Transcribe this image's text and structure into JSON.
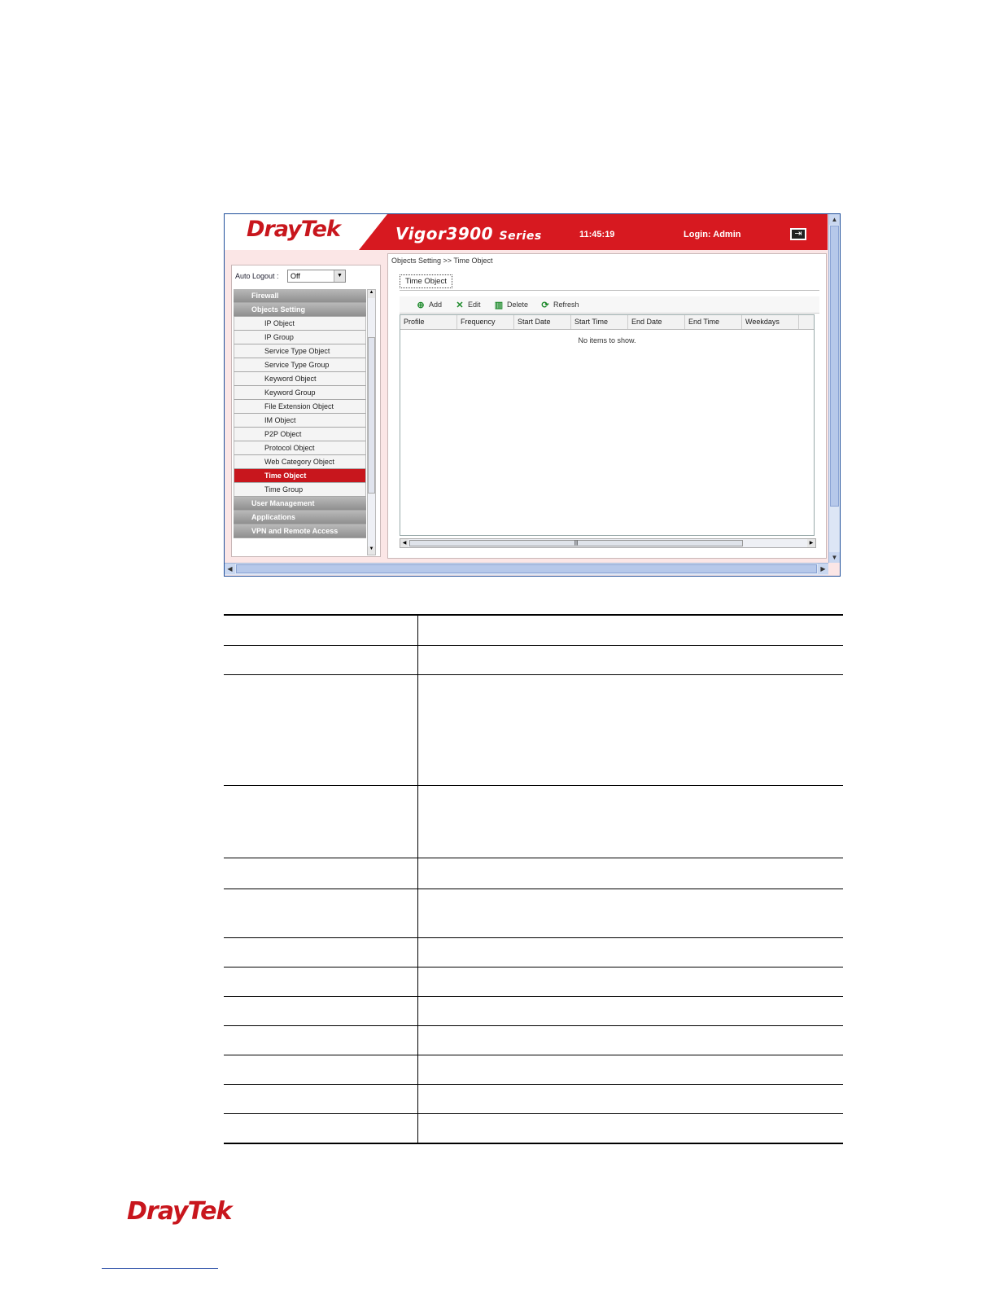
{
  "header": {
    "brand_dray": "Dray",
    "brand_tek": "Tek",
    "model": "Vigor3900",
    "series": "Series",
    "clock": "11:45:19",
    "login": "Login: Admin",
    "logout_icon": "logout-icon"
  },
  "left_panel": {
    "auto_logout_label": "Auto Logout :",
    "auto_logout_value": "Off",
    "menu": [
      {
        "label": "Firewall",
        "type": "group"
      },
      {
        "label": "Objects Setting",
        "type": "group"
      },
      {
        "label": "IP Object",
        "type": "sub"
      },
      {
        "label": "IP Group",
        "type": "sub"
      },
      {
        "label": "Service Type Object",
        "type": "sub"
      },
      {
        "label": "Service Type Group",
        "type": "sub"
      },
      {
        "label": "Keyword Object",
        "type": "sub"
      },
      {
        "label": "Keyword Group",
        "type": "sub"
      },
      {
        "label": "File Extension Object",
        "type": "sub"
      },
      {
        "label": "IM Object",
        "type": "sub"
      },
      {
        "label": "P2P Object",
        "type": "sub"
      },
      {
        "label": "Protocol Object",
        "type": "sub"
      },
      {
        "label": "Web Category Object",
        "type": "sub"
      },
      {
        "label": "Time Object",
        "type": "sub",
        "active": true
      },
      {
        "label": "Time Group",
        "type": "sub"
      },
      {
        "label": "User Management",
        "type": "group"
      },
      {
        "label": "Applications",
        "type": "group"
      },
      {
        "label": "VPN and Remote Access",
        "type": "group"
      }
    ]
  },
  "main": {
    "breadcrumb": "Objects Setting >> Time Object",
    "tab": "Time Object",
    "toolbar": {
      "add": "Add",
      "edit": "Edit",
      "delete": "Delete",
      "refresh": "Refresh"
    },
    "columns": [
      "Profile",
      "Frequency",
      "Start Date",
      "Start Time",
      "End Date",
      "End Time",
      "Weekdays"
    ],
    "empty_message": "No items to show."
  },
  "footer": {
    "logo_dray": "Dray",
    "logo_tek": "Tek"
  },
  "colors": {
    "brand_red": "#c8161d",
    "menu_group": "#9a9a9a"
  }
}
